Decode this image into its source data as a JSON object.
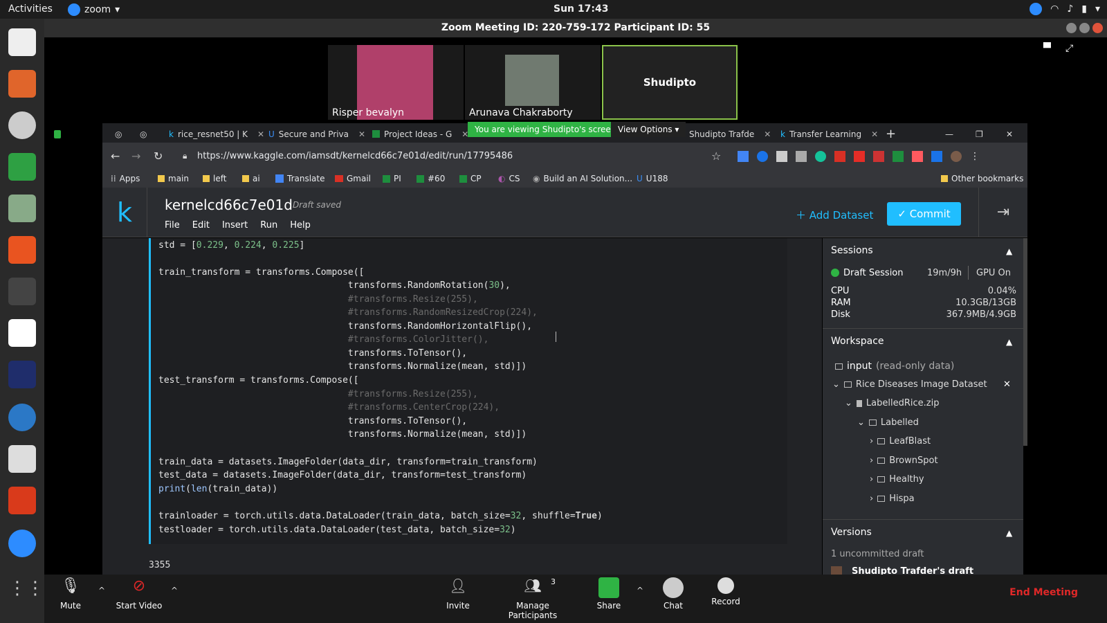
{
  "topbar": {
    "activities": "Activities",
    "app": "zoom",
    "clock": "Sun 17:43"
  },
  "zoom": {
    "title": "Zoom Meeting ID: 220-759-172 Participant ID: 55",
    "participants": [
      "Risper bevalyn",
      "Arunava Chakraborty",
      "Shudipto"
    ],
    "viewing_banner": "You are viewing Shudipto's screen",
    "view_options": "View Options",
    "toolbar": {
      "mute": "Mute",
      "start_video": "Start Video",
      "invite": "Invite",
      "manage_participants": "Manage Participants",
      "participant_count": "3",
      "share": "Share",
      "chat": "Chat",
      "record": "Record",
      "end_meeting": "End Meeting"
    }
  },
  "chrome": {
    "tabs": [
      "rice_resnet50 | K",
      "Secure and Priva",
      "Project Ideas - G",
      "Shudipto Trafde",
      "Transfer Learning"
    ],
    "url": "https://www.kaggle.com/iamsdt/kernelcd66c7e01d/edit/run/17795486",
    "bookmarks": [
      "Apps",
      "main",
      "left",
      "ai",
      "Translate",
      "Gmail",
      "PI",
      "#60",
      "CP",
      "CS",
      "Build an AI Solution...",
      "U188"
    ],
    "other_bookmarks": "Other bookmarks"
  },
  "kaggle": {
    "logo": "k",
    "title": "kernelcd66c7e01d",
    "status": "Draft saved",
    "menu": [
      "File",
      "Edit",
      "Insert",
      "Run",
      "Help"
    ],
    "add_dataset": "Add Dataset",
    "commit": "Commit",
    "output": "3355"
  },
  "sessions": {
    "header": "Sessions",
    "name": "Draft Session",
    "time": "19m/9h",
    "gpu": "GPU On",
    "cpu_label": "CPU",
    "cpu": "0.04%",
    "ram_label": "RAM",
    "ram": "10.3GB/13GB",
    "disk_label": "Disk",
    "disk": "367.9MB/4.9GB"
  },
  "workspace": {
    "header": "Workspace",
    "input": "input",
    "input_note": "(read-only data)",
    "dataset": "Rice Diseases Image Dataset",
    "zip": "LabelledRice.zip",
    "labelled": "Labelled",
    "folders": [
      "LeafBlast",
      "BrownSpot",
      "Healthy",
      "Hispa"
    ]
  },
  "versions": {
    "header": "Versions",
    "uncommitted": "1 uncommitted draft",
    "draft_owner": "Shudipto Trafder's draft"
  },
  "colors": {
    "kaggle_blue": "#20beff",
    "zoom_green": "#2fb344",
    "end_red": "#e02828"
  }
}
